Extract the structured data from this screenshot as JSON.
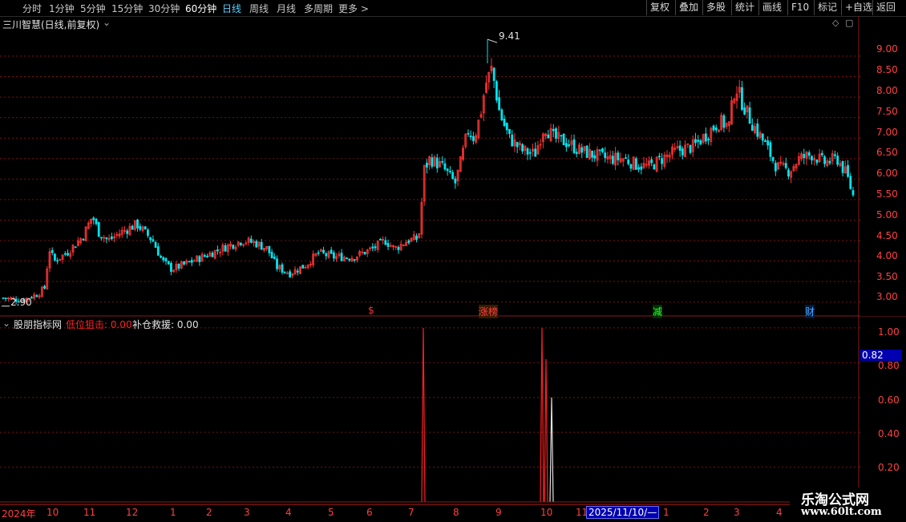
{
  "topbar": {
    "periods": [
      {
        "label": "分时"
      },
      {
        "label": "1分钟"
      },
      {
        "label": "5分钟"
      },
      {
        "label": "15分钟"
      },
      {
        "label": "30分钟"
      },
      {
        "label": "60分钟"
      },
      {
        "label": "日线"
      },
      {
        "label": "周线"
      },
      {
        "label": "月线"
      },
      {
        "label": "多周期"
      },
      {
        "label": "更多 >"
      }
    ],
    "active_period": "日线",
    "right_buttons": [
      {
        "label": "复权"
      },
      {
        "label": "叠加"
      },
      {
        "label": "多股"
      },
      {
        "label": "统计"
      },
      {
        "label": "画线"
      },
      {
        "label": "F10"
      },
      {
        "label": "标记"
      },
      {
        "label": "+自选"
      },
      {
        "label": "返回"
      }
    ]
  },
  "main_panel": {
    "title": "三川智慧(日线,前复权)",
    "high_label": "9.41",
    "low_label": "2.90",
    "markers": [
      {
        "text": "$",
        "color": "#ff3030"
      },
      {
        "text": "涨榜",
        "color": "#ff4040"
      },
      {
        "text": "减",
        "color": "#30ff30"
      },
      {
        "text": "财",
        "color": "#4da6ff"
      }
    ],
    "price_axis": [
      "9.00",
      "8.50",
      "8.00",
      "7.50",
      "7.00",
      "6.50",
      "6.00",
      "5.50",
      "5.00",
      "4.50",
      "4.00",
      "3.50",
      "3.00"
    ]
  },
  "indicator_panel": {
    "name": "股朋指标网",
    "line1_label": "低位狙击: 0.00",
    "line2_label": "补仓救援: 0.00",
    "axis": [
      "1.00",
      "0.80",
      "0.60",
      "0.40",
      "0.20"
    ],
    "current_value": "0.82",
    "colors": {
      "line1": "#ff2020",
      "line2": "#e0e0e0"
    }
  },
  "time_axis": {
    "labels": [
      "2024年",
      "10",
      "11",
      "12",
      "1",
      "2",
      "3",
      "4",
      "5",
      "6",
      "7",
      "8",
      "9",
      "10",
      "11",
      "1",
      "2",
      "3",
      "4"
    ],
    "cursor_date": "2025/11/10/—"
  },
  "watermark": {
    "line1": "乐淘公式网",
    "line2": "www.60lt.com"
  },
  "colors": {
    "up": "#ff3333",
    "down": "#00e5ee",
    "grid": "#8a1a1a",
    "axis": "#c8c8c8"
  },
  "chart_data": {
    "type": "candlestick",
    "price_range": [
      2.7,
      9.9
    ],
    "indicator_range": [
      0,
      1.05
    ],
    "candle_count": 330,
    "close_anchors": [
      [
        0,
        3.1
      ],
      [
        12,
        3.05
      ],
      [
        22,
        3.2
      ],
      [
        26,
        3.35
      ],
      [
        29,
        4.3
      ],
      [
        32,
        4.0
      ],
      [
        40,
        4.2
      ],
      [
        50,
        4.6
      ],
      [
        56,
        5.1
      ],
      [
        60,
        4.7
      ],
      [
        66,
        4.5
      ],
      [
        74,
        4.7
      ],
      [
        84,
        4.9
      ],
      [
        94,
        4.5
      ],
      [
        100,
        4.0
      ],
      [
        106,
        3.8
      ],
      [
        116,
        3.95
      ],
      [
        128,
        4.15
      ],
      [
        140,
        4.35
      ],
      [
        150,
        4.5
      ],
      [
        158,
        4.45
      ],
      [
        166,
        4.3
      ],
      [
        172,
        3.85
      ],
      [
        180,
        3.7
      ],
      [
        190,
        3.9
      ],
      [
        198,
        4.2
      ],
      [
        208,
        4.1
      ],
      [
        220,
        4.1
      ],
      [
        232,
        4.3
      ],
      [
        240,
        4.5
      ],
      [
        246,
        4.3
      ],
      [
        254,
        4.5
      ],
      [
        260,
        4.55
      ],
      [
        262,
        4.75
      ],
      [
        264,
        6.2
      ],
      [
        268,
        6.5
      ],
      [
        276,
        6.3
      ],
      [
        284,
        5.9
      ],
      [
        288,
        6.5
      ],
      [
        292,
        7.2
      ],
      [
        296,
        7.0
      ],
      [
        300,
        7.6
      ],
      [
        303,
        8.3
      ],
      [
        307,
        8.7
      ],
      [
        312,
        7.6
      ],
      [
        318,
        7.0
      ],
      [
        326,
        6.7
      ],
      [
        334,
        6.6
      ],
      [
        340,
        7.3
      ],
      [
        346,
        7.0
      ],
      [
        354,
        6.9
      ],
      [
        362,
        6.7
      ],
      [
        370,
        6.6
      ],
      [
        380,
        6.5
      ],
      [
        390,
        6.5
      ],
      [
        398,
        6.35
      ],
      [
        406,
        6.3
      ],
      [
        414,
        6.5
      ],
      [
        424,
        6.7
      ],
      [
        434,
        6.8
      ],
      [
        442,
        7.1
      ],
      [
        450,
        7.4
      ],
      [
        456,
        7.3
      ],
      [
        460,
        8.3
      ],
      [
        464,
        7.9
      ],
      [
        470,
        7.4
      ],
      [
        478,
        6.9
      ],
      [
        486,
        6.3
      ],
      [
        494,
        6.2
      ],
      [
        500,
        6.5
      ],
      [
        508,
        6.6
      ],
      [
        516,
        6.4
      ],
      [
        524,
        6.5
      ],
      [
        530,
        6.1
      ],
      [
        534,
        5.6
      ]
    ],
    "indicator_spikes": [
      {
        "series": "低位狙击",
        "value": 1.0
      },
      {
        "series": "低位狙击",
        "value": 1.0
      },
      {
        "series": "低位狙击",
        "value": 0.82
      },
      {
        "series": "补仓救援",
        "value": 0.6
      }
    ],
    "high": 9.41,
    "low": 2.9
  }
}
